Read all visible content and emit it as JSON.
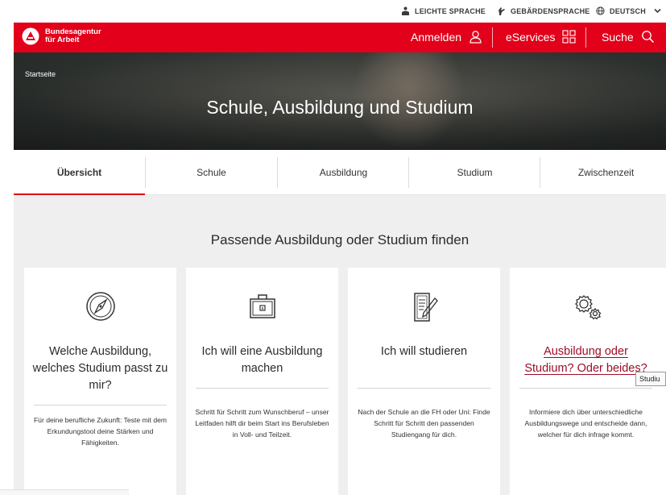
{
  "utility": {
    "easy_language": "LEICHTE SPRACHE",
    "sign_language": "GEBÄRDENSPRACHE",
    "language": "DEUTSCH"
  },
  "header": {
    "logo_text": "Bundesagentur\nfür Arbeit",
    "login": "Anmelden",
    "eservices": "eServices",
    "search": "Suche",
    "brand_color": "#e2001a"
  },
  "hero": {
    "breadcrumb": "Startseite",
    "title": "Schule, Ausbildung und Studium"
  },
  "tabs": [
    {
      "label": "Übersicht",
      "active": true
    },
    {
      "label": "Schule",
      "active": false
    },
    {
      "label": "Ausbildung",
      "active": false
    },
    {
      "label": "Studium",
      "active": false
    },
    {
      "label": "Zwischenzeit",
      "active": false
    }
  ],
  "main": {
    "section_title": "Passende Ausbildung oder Studium finden",
    "cards": [
      {
        "icon": "compass-icon",
        "title": "Welche Ausbildung, welches Studium passt zu mir?",
        "text": "Für deine berufliche Zukunft: Teste mit dem Erkundungstool deine Stärken und Fähigkeiten."
      },
      {
        "icon": "briefcase-icon",
        "title": "Ich will eine Ausbildung machen",
        "text": "Schritt für Schritt zum Wunschberuf – unser Leitfaden hilft dir beim Start ins Berufsleben in Voll- und Teilzeit."
      },
      {
        "icon": "document-pen-icon",
        "title": "Ich will studieren",
        "text": "Nach der Schule an die FH oder Uni: Finde Schritt für Schritt den passenden Studiengang für dich."
      },
      {
        "icon": "gears-icon",
        "title": "Ausbildung oder Studium? Oder beides?",
        "text": "Informiere dich über unterschiedliche Ausbildungswege und entscheide dann, welcher für dich infrage kommt."
      }
    ]
  },
  "tooltip": "Studiu"
}
